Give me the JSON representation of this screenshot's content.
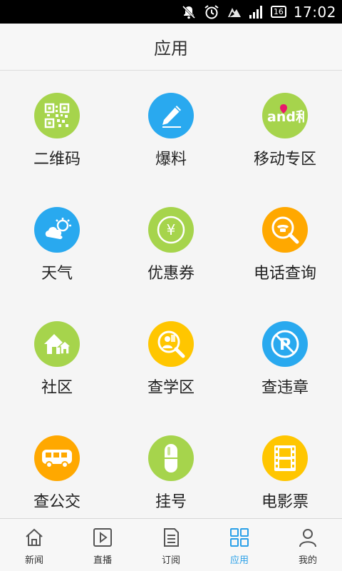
{
  "status_bar": {
    "time": "17:02",
    "sim_badge": "16",
    "icons": [
      "mute-icon",
      "alarm-icon",
      "wifi-icon",
      "signal-icon"
    ]
  },
  "header": {
    "title": "应用"
  },
  "apps": [
    {
      "label": "二维码",
      "icon": "qr-code-icon",
      "color": "#a6d44c"
    },
    {
      "label": "爆料",
      "icon": "pencil-icon",
      "color": "#29a9ef"
    },
    {
      "label": "移动专区",
      "icon": "mobile-and-logo-icon",
      "color": "#a6d44c",
      "logo_text": "and和"
    },
    {
      "label": "天气",
      "icon": "weather-icon",
      "color": "#29a9ef"
    },
    {
      "label": "优惠券",
      "icon": "coupon-icon",
      "color": "#a6d44c",
      "glyph": "¥"
    },
    {
      "label": "电话查询",
      "icon": "phone-search-icon",
      "color": "#ffa800"
    },
    {
      "label": "社区",
      "icon": "community-icon",
      "color": "#a6d44c"
    },
    {
      "label": "查学区",
      "icon": "school-search-icon",
      "color": "#ffc600"
    },
    {
      "label": "查违章",
      "icon": "no-parking-icon",
      "color": "#29a9ef",
      "glyph": "P"
    },
    {
      "label": "查公交",
      "icon": "bus-icon",
      "color": "#ffa800"
    },
    {
      "label": "挂号",
      "icon": "medicine-icon",
      "color": "#a6d44c"
    },
    {
      "label": "电影票",
      "icon": "film-icon",
      "color": "#ffc600"
    }
  ],
  "tabs": [
    {
      "label": "新闻",
      "icon": "home-icon",
      "active": false
    },
    {
      "label": "直播",
      "icon": "play-icon",
      "active": false
    },
    {
      "label": "订阅",
      "icon": "document-icon",
      "active": false
    },
    {
      "label": "应用",
      "icon": "apps-grid-icon",
      "active": true
    },
    {
      "label": "我的",
      "icon": "user-icon",
      "active": false
    }
  ],
  "colors": {
    "accent": "#2aa0e8",
    "icon_inactive": "#555555"
  }
}
